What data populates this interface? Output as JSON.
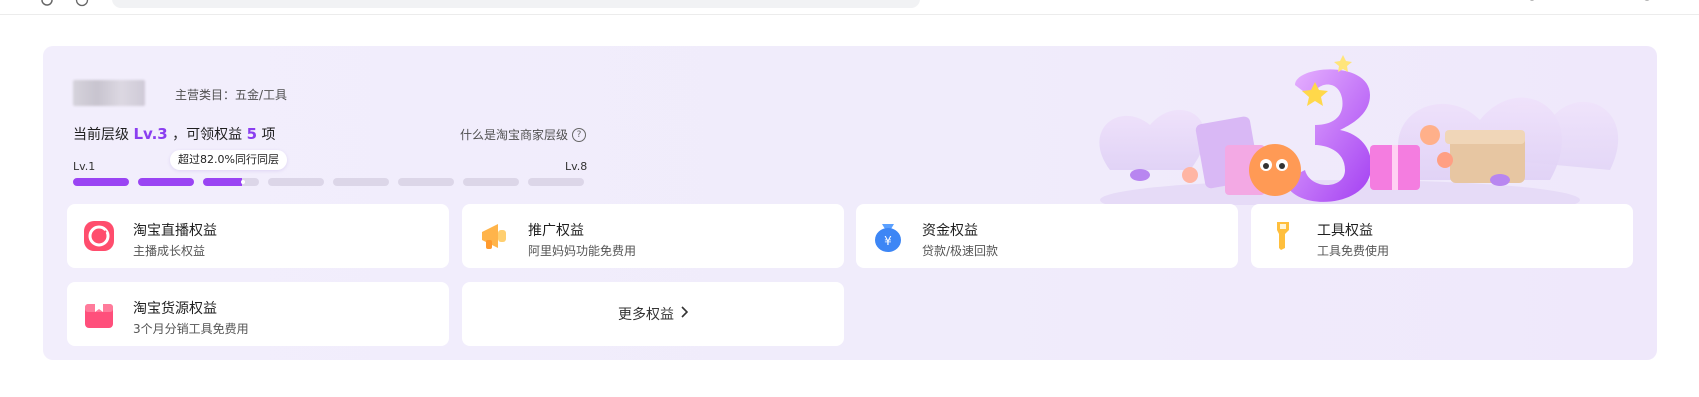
{
  "store": {
    "category": "主营类目：五金/工具"
  },
  "level": {
    "prefix": "当前层级",
    "current": "Lv.3",
    "middle": "，可领权益",
    "benefits_count": "5",
    "suffix": "项",
    "what_is": "什么是淘宝商家层级",
    "min_label": "Lv.1",
    "max_label": "Lv.8",
    "tooltip": "超过82.0%同行同层",
    "progress_fraction": 0.2857
  },
  "benefits": [
    {
      "title": "淘宝直播权益",
      "subtitle": "主播成长权益",
      "icon": "live-icon"
    },
    {
      "title": "推广权益",
      "subtitle": "阿里妈妈功能免费用",
      "icon": "megaphone-icon"
    },
    {
      "title": "资金权益",
      "subtitle": "贷款/极速回款",
      "icon": "money-bag-icon"
    },
    {
      "title": "工具权益",
      "subtitle": "工具免费使用",
      "icon": "wrench-icon"
    },
    {
      "title": "淘宝货源权益",
      "subtitle": "3个月分销工具免费用",
      "icon": "gift-box-icon"
    }
  ],
  "more": {
    "label": "更多权益"
  },
  "colors": {
    "accent": "#9a44f3",
    "card_bg": "#f0ecfb"
  }
}
